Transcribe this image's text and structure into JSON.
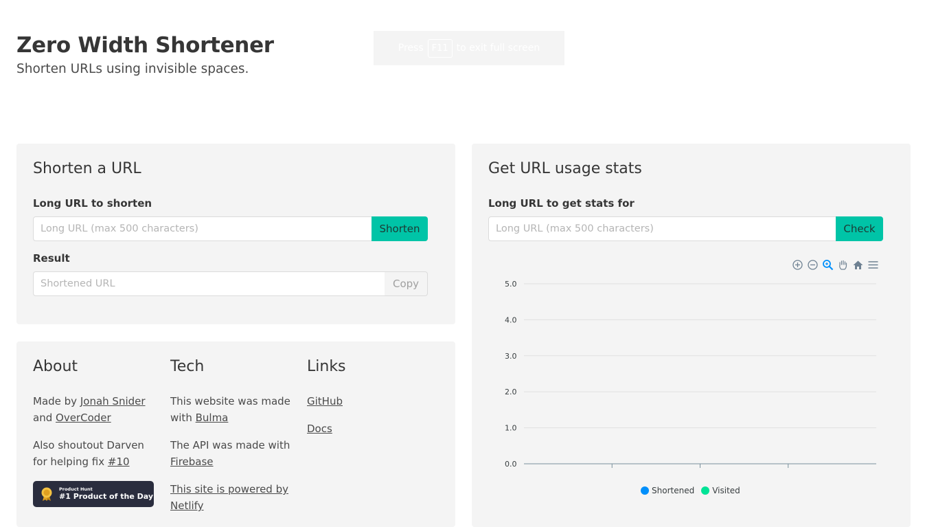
{
  "header": {
    "title": "Zero Width Shortener",
    "subtitle": "Shorten URLs using invisible spaces."
  },
  "fullscreen_hint": {
    "prefix": "Press",
    "key": "F11",
    "suffix": "to exit full screen"
  },
  "shorten": {
    "title": "Shorten a URL",
    "long_label": "Long URL to shorten",
    "long_placeholder": "Long URL (max 500 characters)",
    "shorten_button": "Shorten",
    "result_label": "Result",
    "result_placeholder": "Shortened URL",
    "copy_button": "Copy"
  },
  "about": {
    "title": "About",
    "made_by_prefix": "Made by",
    "author": "Jonah Snider",
    "and": "and",
    "coauthor": "OverCoder",
    "shoutout": "Also shoutout Darven for helping fix",
    "issue": "#10",
    "badge_small": "Product Hunt",
    "badge_big": "#1 Product of the Day"
  },
  "tech": {
    "title": "Tech",
    "site_prefix": "This website was made with",
    "site_link": "Bulma",
    "api_prefix": "The API was made with",
    "api_link": "Firebase",
    "netlify": "This site is powered by Netlify"
  },
  "links": {
    "title": "Links",
    "items": [
      "GitHub",
      "Docs"
    ]
  },
  "stats": {
    "title": "Get URL usage stats",
    "label": "Long URL to get stats for",
    "placeholder": "Long URL (max 500 characters)",
    "check_button": "Check"
  },
  "colors": {
    "accent": "#00c4a7",
    "shortened": "#008ffb",
    "visited": "#00e396"
  },
  "chart_data": {
    "type": "line",
    "y_ticks": [
      "5.0",
      "4.0",
      "3.0",
      "2.0",
      "1.0",
      "0.0"
    ],
    "ylim": [
      0,
      5
    ],
    "x_categories": 4,
    "grid": true,
    "legend_position": "bottom-center",
    "series": [
      {
        "name": "Shortened",
        "values": []
      },
      {
        "name": "Visited",
        "values": []
      }
    ]
  }
}
